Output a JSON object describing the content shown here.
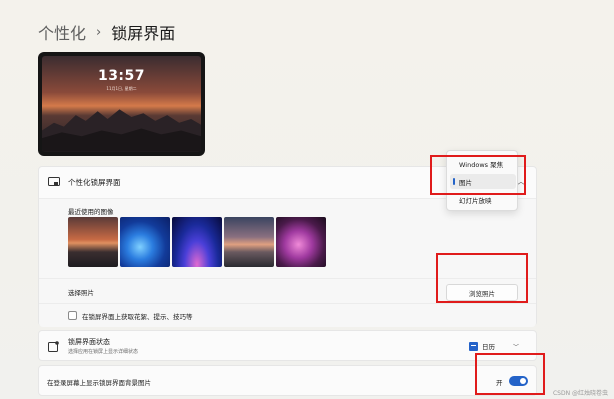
{
  "breadcrumb": {
    "parent": "个性化",
    "separator": "›",
    "current": "锁屏界面"
  },
  "preview": {
    "time": "13:57",
    "date": "11月1日, 星期二"
  },
  "personalize": {
    "title": "个性化锁屏界面",
    "recent_label": "最近使用的图像",
    "choose_label": "选择照片",
    "browse_button": "浏览照片",
    "tips_checkbox": "在锁屏界面上获取花絮、提示、技巧等",
    "tips_checked": false,
    "dropdown_options": [
      "Windows 聚焦",
      "图片",
      "幻灯片放映"
    ],
    "dropdown_selected": "图片"
  },
  "status": {
    "title": "锁屏界面状态",
    "subtitle": "选择应用在锁屏上显示详细状态",
    "selected_app": "日历"
  },
  "login": {
    "title": "在登录屏幕上显示锁屏界面背景图片",
    "toggle_label": "开",
    "toggle_on": true
  },
  "colors": {
    "accent": "#2463c8",
    "highlight": "#e01b1b"
  },
  "watermark": "CSDN @红烛晓卷虫"
}
